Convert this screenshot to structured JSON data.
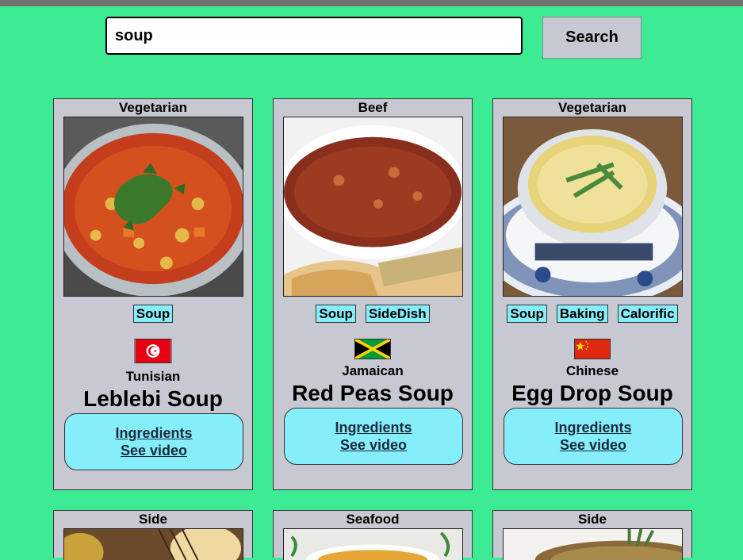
{
  "search": {
    "value": "soup",
    "button_label": "Search"
  },
  "meals": [
    {
      "category": "Vegetarian",
      "tags": [
        "Soup"
      ],
      "area": "Tunisian",
      "flag": "tunisia-flag",
      "name": "Leblebi Soup",
      "ingredients_label": "Ingredients",
      "video_label": "See video"
    },
    {
      "category": "Beef",
      "tags": [
        "Soup",
        "SideDish"
      ],
      "area": "Jamaican",
      "flag": "jamaica-flag",
      "name": "Red Peas Soup",
      "ingredients_label": "Ingredients",
      "video_label": "See video"
    },
    {
      "category": "Vegetarian",
      "tags": [
        "Soup",
        "Baking",
        "Calorific"
      ],
      "area": "Chinese",
      "flag": "china-flag",
      "name": "Egg Drop Soup",
      "ingredients_label": "Ingredients",
      "video_label": "See video"
    },
    {
      "category": "Side"
    },
    {
      "category": "Seafood"
    },
    {
      "category": "Side"
    }
  ],
  "colors": {
    "background": "#3deb94",
    "card": "#c8c8d2",
    "tag": "#86edfb",
    "links_box": "#86edfb"
  }
}
